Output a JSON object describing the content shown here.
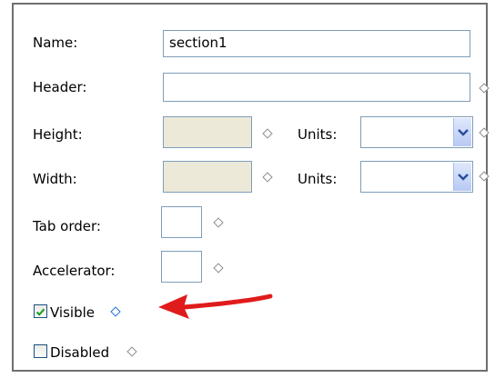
{
  "form": {
    "name_label": "Name:",
    "name_value": "section1",
    "header_label": "Header:",
    "header_value": "",
    "height_label": "Height:",
    "height_value": "",
    "height_units_label": "Units:",
    "height_units_value": "",
    "width_label": "Width:",
    "width_value": "",
    "width_units_label": "Units:",
    "width_units_value": "",
    "tab_order_label": "Tab order:",
    "tab_order_value": "",
    "accelerator_label": "Accelerator:",
    "accelerator_value": "",
    "visible_label": "Visible",
    "visible_checked": true,
    "disabled_label": "Disabled",
    "disabled_checked": false
  },
  "colors": {
    "disabled_field": "#ece9d8",
    "arrow": "#e01b1b",
    "diamond_active": "#1a73d9",
    "diamond_default": "#8c8c8c"
  },
  "icons": {
    "property_marker": "diamond",
    "dropdown": "chevron-down",
    "annotation": "red-arrow-left"
  }
}
